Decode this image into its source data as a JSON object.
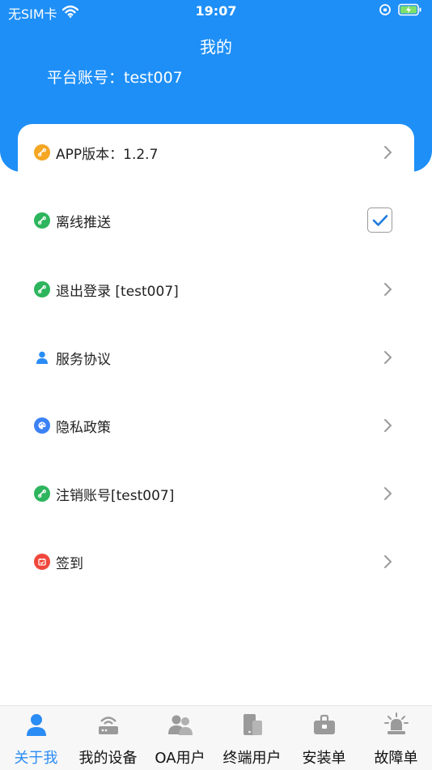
{
  "status_bar": {
    "carrier": "无SIM卡",
    "time": "19:07"
  },
  "header": {
    "title": "我的",
    "account_label": "平台账号：",
    "account_value": "test007"
  },
  "menu": {
    "items": [
      {
        "label": "APP版本：1.2.7",
        "icon": "link-icon",
        "icon_color": "#f5a623",
        "control": "chevron"
      },
      {
        "label": "离线推送",
        "icon": "link-icon",
        "icon_color": "#2db55d",
        "control": "checkbox",
        "checked": true
      },
      {
        "label": "退出登录 [test007]",
        "icon": "link-icon",
        "icon_color": "#2db55d",
        "control": "chevron"
      },
      {
        "label": "服务协议",
        "icon": "person-icon",
        "icon_color": "#2a8cf5",
        "control": "chevron"
      },
      {
        "label": "隐私政策",
        "icon": "palette-icon",
        "icon_color": "#3c82f6",
        "control": "chevron"
      },
      {
        "label": "注销账号[test007]",
        "icon": "link-icon",
        "icon_color": "#2db55d",
        "control": "chevron"
      },
      {
        "label": "签到",
        "icon": "calendar-icon",
        "icon_color": "#f0473c",
        "control": "chevron"
      }
    ]
  },
  "tabbar": {
    "tabs": [
      {
        "label": "关于我",
        "icon": "user-icon",
        "active": true
      },
      {
        "label": "我的设备",
        "icon": "router-icon",
        "active": false
      },
      {
        "label": "OA用户",
        "icon": "users-icon",
        "active": false
      },
      {
        "label": "终端用户",
        "icon": "devices-icon",
        "active": false
      },
      {
        "label": "安装单",
        "icon": "toolbox-icon",
        "active": false
      },
      {
        "label": "故障单",
        "icon": "alarm-icon",
        "active": false
      }
    ]
  },
  "colors": {
    "header_bg": "#1e8ff7",
    "active_tab": "#2a8cf5",
    "inactive_tab_icon": "#9a9a9a"
  }
}
